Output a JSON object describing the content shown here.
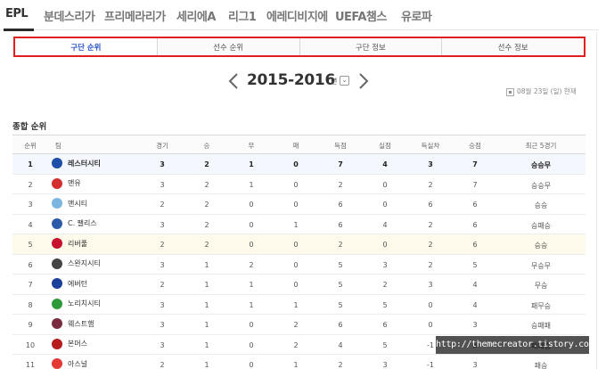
{
  "leagues": [
    "EPL",
    "분데스리가",
    "프리메라리가",
    "세리에A",
    "리그1",
    "에레디비지에",
    "UEFA챔스",
    "유로파"
  ],
  "subtabs": [
    "구단 순위",
    "선수 순위",
    "구단 정보",
    "선수 정보"
  ],
  "season": {
    "title": "2015-2016",
    "suffix": "년",
    "dropdown": "⌄",
    "prev_icon": "chevron-left-icon",
    "next_icon": "chevron-right-icon"
  },
  "as_of": {
    "icon": "calendar-icon",
    "text": "08월 23일 (일) 현재"
  },
  "section_title": "종합 순위",
  "columns": {
    "rank": "순위",
    "team": "팀",
    "played": "경기",
    "win": "승",
    "draw": "무",
    "loss": "패",
    "gf": "득점",
    "ga": "실점",
    "gd": "득실차",
    "pts": "승점",
    "recent": "최근 5경기"
  },
  "standings": [
    {
      "rank": "1",
      "team": "레스터시티",
      "played": "3",
      "win": "2",
      "draw": "1",
      "loss": "0",
      "gf": "7",
      "ga": "4",
      "gd": "3",
      "pts": "7",
      "recent": "승승무",
      "color": "#1f4fa8"
    },
    {
      "rank": "2",
      "team": "맨유",
      "played": "3",
      "win": "2",
      "draw": "1",
      "loss": "0",
      "gf": "2",
      "ga": "0",
      "gd": "2",
      "pts": "7",
      "recent": "승승무",
      "color": "#d32f2f"
    },
    {
      "rank": "3",
      "team": "맨시티",
      "played": "2",
      "win": "2",
      "draw": "0",
      "loss": "0",
      "gf": "6",
      "ga": "0",
      "gd": "6",
      "pts": "6",
      "recent": "승승",
      "color": "#7cb5e0"
    },
    {
      "rank": "4",
      "team": "C. 팰리스",
      "played": "3",
      "win": "2",
      "draw": "0",
      "loss": "1",
      "gf": "6",
      "ga": "4",
      "gd": "2",
      "pts": "6",
      "recent": "승패승",
      "color": "#2a5aa8"
    },
    {
      "rank": "5",
      "team": "리버풀",
      "played": "2",
      "win": "2",
      "draw": "0",
      "loss": "0",
      "gf": "2",
      "ga": "0",
      "gd": "2",
      "pts": "6",
      "recent": "승승",
      "color": "#c8102e"
    },
    {
      "rank": "6",
      "team": "스완지시티",
      "played": "3",
      "win": "1",
      "draw": "2",
      "loss": "0",
      "gf": "5",
      "ga": "3",
      "gd": "2",
      "pts": "5",
      "recent": "무승무",
      "color": "#444444"
    },
    {
      "rank": "7",
      "team": "에버턴",
      "played": "2",
      "win": "1",
      "draw": "1",
      "loss": "0",
      "gf": "5",
      "ga": "2",
      "gd": "3",
      "pts": "4",
      "recent": "무승",
      "color": "#1b3f9c"
    },
    {
      "rank": "8",
      "team": "노리치시티",
      "played": "3",
      "win": "1",
      "draw": "1",
      "loss": "1",
      "gf": "5",
      "ga": "5",
      "gd": "0",
      "pts": "4",
      "recent": "패무승",
      "color": "#2e9b3a"
    },
    {
      "rank": "9",
      "team": "웨스트햄",
      "played": "3",
      "win": "1",
      "draw": "0",
      "loss": "2",
      "gf": "6",
      "ga": "6",
      "gd": "0",
      "pts": "3",
      "recent": "승패패",
      "color": "#7a2a3e"
    },
    {
      "rank": "10",
      "team": "본머스",
      "played": "3",
      "win": "1",
      "draw": "0",
      "loss": "2",
      "gf": "4",
      "ga": "5",
      "gd": "-1",
      "pts": "3",
      "recent": "패패승",
      "color": "#b71c1c"
    },
    {
      "rank": "11",
      "team": "아스널",
      "played": "2",
      "win": "1",
      "draw": "0",
      "loss": "1",
      "gf": "2",
      "ga": "3",
      "gd": "-1",
      "pts": "3",
      "recent": "패승",
      "color": "#e53935"
    }
  ],
  "watermark": "http://themecreator.tistory.com"
}
